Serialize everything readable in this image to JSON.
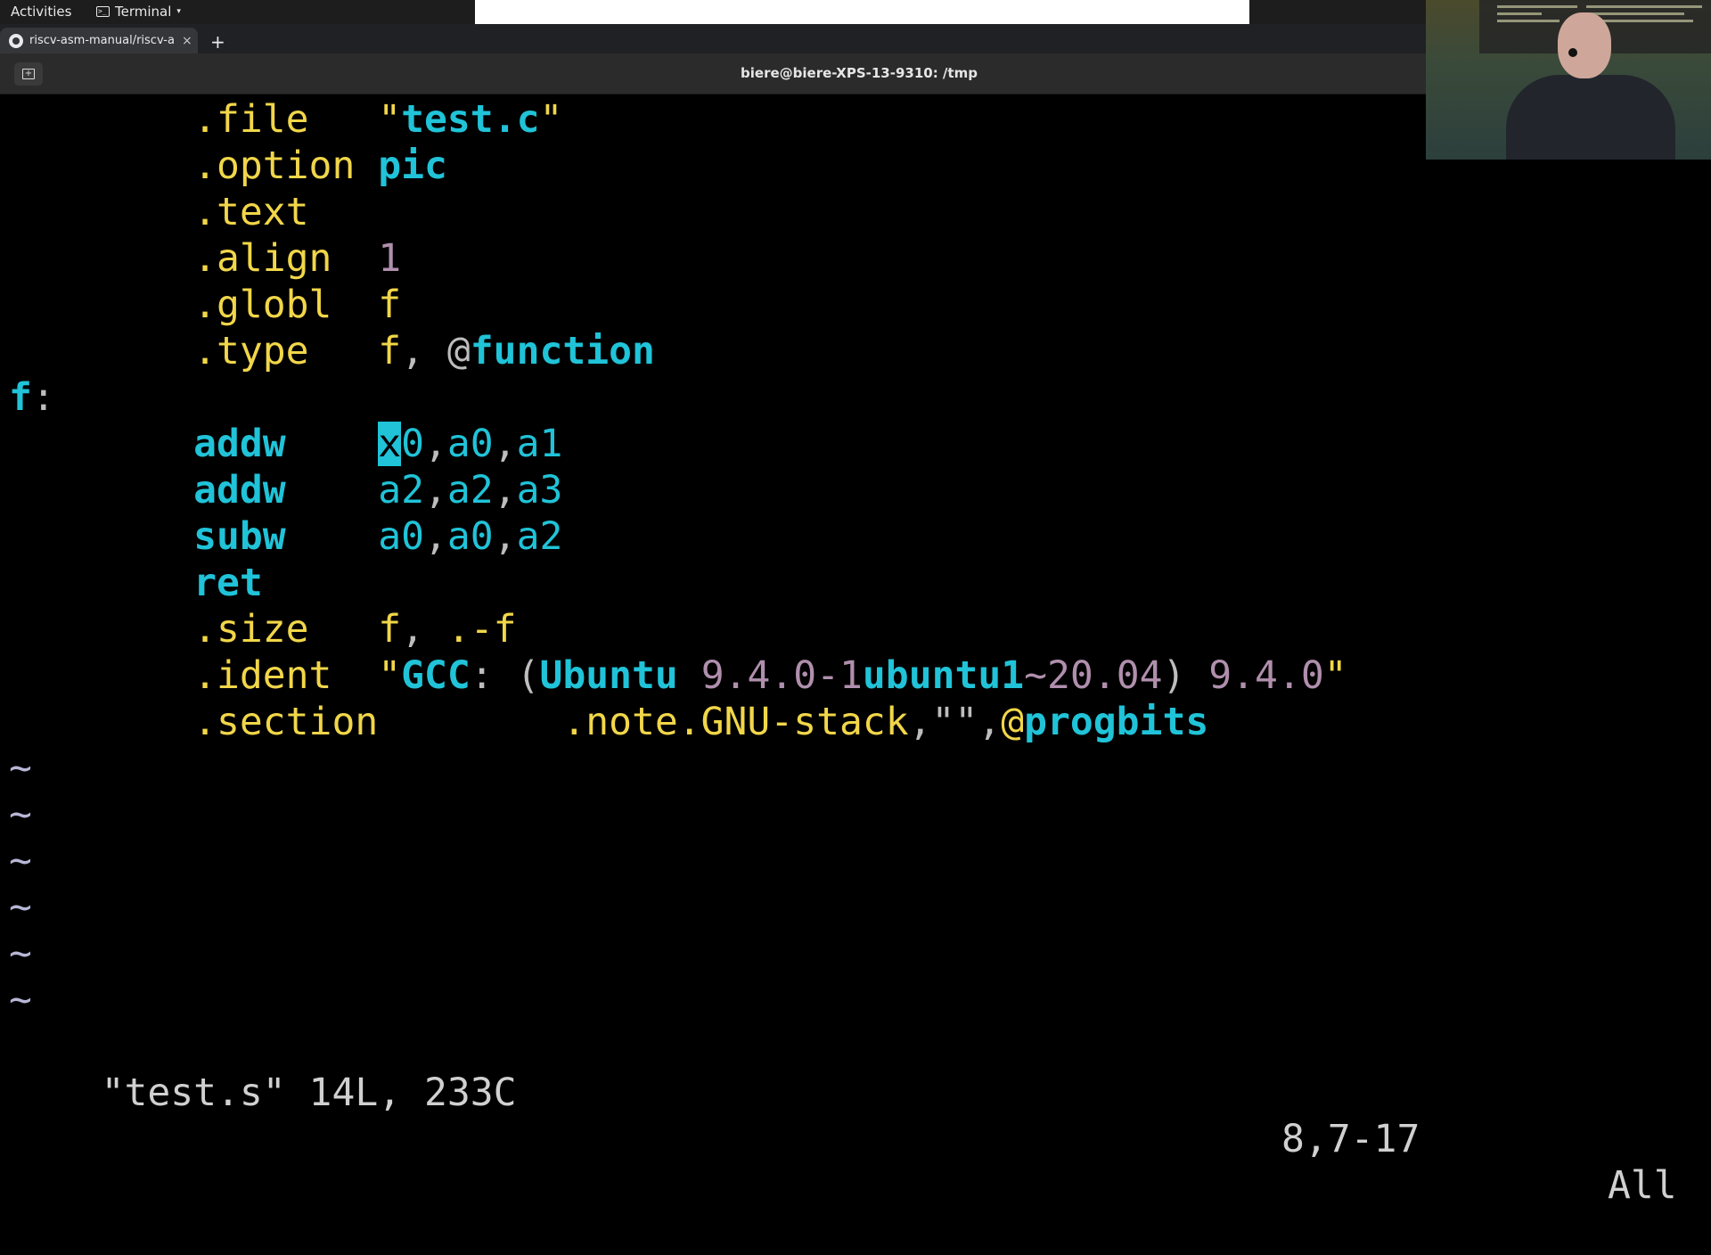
{
  "topbar": {
    "activities": "Activities",
    "app_name": "Terminal",
    "caret": "▾",
    "term_glyph": ">_"
  },
  "browser": {
    "tab_title": "riscv-asm-manual/riscv-a",
    "tab_close": "×",
    "new_tab": "+"
  },
  "terminal": {
    "window_title": "biere@biere-XPS-13-9310: /tmp",
    "new_tab_glyph": "+"
  },
  "editor": {
    "lines": {
      "l1": {
        "directive": ".file",
        "pad": "   ",
        "q1": "\"",
        "arg": "test.c",
        "q2": "\""
      },
      "l2": {
        "directive": ".option",
        "pad": " ",
        "arg": "pic"
      },
      "l3": {
        "directive": ".text"
      },
      "l4": {
        "directive": ".align",
        "pad": "  ",
        "arg": "1"
      },
      "l5": {
        "directive": ".globl",
        "pad": "  ",
        "arg": "f"
      },
      "l6": {
        "directive": ".type",
        "pad": "   ",
        "arg1": "f",
        "sep": ", ",
        "at": "@",
        "arg2": "function"
      },
      "l7": {
        "label": "f",
        "colon": ":"
      },
      "l8": {
        "op": "addw",
        "pad": "    ",
        "cursor_char": "x",
        "rest": "0",
        "c1": ",",
        "r2": "a0",
        "c2": ",",
        "r3": "a1"
      },
      "l9": {
        "op": "addw",
        "pad": "    ",
        "r1": "a2",
        "c1": ",",
        "r2": "a2",
        "c2": ",",
        "r3": "a3"
      },
      "l10": {
        "op": "subw",
        "pad": "    ",
        "r1": "a0",
        "c1": ",",
        "r2": "a0",
        "c2": ",",
        "r3": "a2"
      },
      "l11": {
        "op": "ret"
      },
      "l12": {
        "directive": ".size",
        "pad": "   ",
        "arg1": "f",
        "sep": ", ",
        "arg2": ".-f"
      },
      "l13": {
        "directive": ".ident",
        "pad": "  ",
        "q1": "\"",
        "t1": "GCC",
        "t2": ": (",
        "t3": "Ubuntu",
        "t4": " 9.4.0-1",
        "t5": "ubuntu1",
        "t6": "~20.04",
        "t7": ") ",
        "t8": "9.4.0",
        "q2": "\""
      },
      "l14": {
        "directive": ".section",
        "pad": "        ",
        "t1": ".note.GNU-stack",
        "t2": ",\"\",",
        "at": "@",
        "t3": "progbits"
      }
    },
    "tilde": "~"
  },
  "status_line": {
    "file_info": "\"test.s\" 14L, 233C",
    "position": "8,7-17",
    "scroll": "All"
  }
}
